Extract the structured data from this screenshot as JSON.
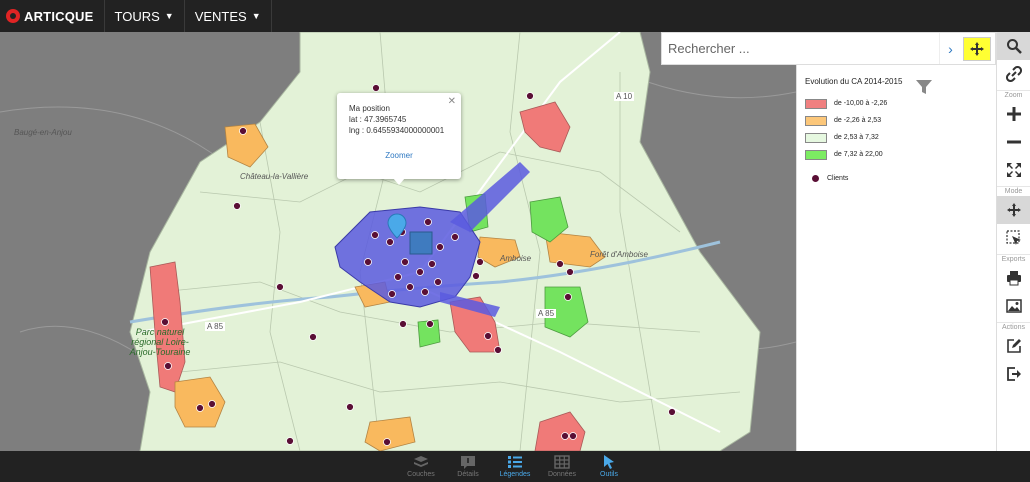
{
  "app": {
    "logo": "ARTICQUE"
  },
  "nav": {
    "menus": [
      {
        "label": "TOURS"
      },
      {
        "label": "VENTES"
      }
    ]
  },
  "search": {
    "placeholder": "Rechercher ..."
  },
  "popup": {
    "title": "Ma position",
    "lat": "lat : 47.3965745",
    "lng": "lng : 0.6455934000000001",
    "zoom_label": "Zoomer"
  },
  "legend": {
    "title": "Evolution du CA 2014-2015",
    "classes": [
      {
        "label": "de -10,00 à -2,26",
        "color": "#f08080"
      },
      {
        "label": "de -2,26 à 2,53",
        "color": "#fcc77a"
      },
      {
        "label": "de 2,53 à 7,32",
        "color": "#e6f8e0"
      },
      {
        "label": "de 7,32 à 22,00",
        "color": "#7cec62"
      }
    ],
    "clients_label": "Clients",
    "clients_color": "#5a0f35"
  },
  "map": {
    "labels": [
      "Baugé-en-Anjou",
      "Château-la-Vallière",
      "Parc naturel régional Loire-Anjou-Touraine",
      "Amboise",
      "Forêt d'Amboise",
      "A 10",
      "A 85",
      "A 85"
    ]
  },
  "toolbar": {
    "sections": [
      "Zoom",
      "Mode",
      "Exports",
      "Actions"
    ]
  },
  "bottom_tabs": [
    {
      "label": "Couches",
      "icon": "layers-icon"
    },
    {
      "label": "Détails",
      "icon": "details-icon"
    },
    {
      "label": "Légendes",
      "icon": "legend-icon",
      "active": true
    },
    {
      "label": "Données",
      "icon": "grid-icon"
    },
    {
      "label": "Outils",
      "icon": "cursor-icon"
    }
  ],
  "colors": {
    "accent": "#4aa9e9",
    "highlight": "#ffff33",
    "metropole": "#5a5ae0"
  }
}
